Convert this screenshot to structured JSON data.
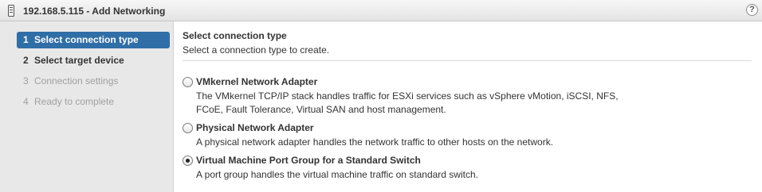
{
  "window": {
    "title": "192.168.5.115 - Add Networking",
    "host_icon": "host-server-icon",
    "help_icon": "help-icon",
    "help_glyph": "?"
  },
  "steps": [
    {
      "number": "1",
      "label": "Select connection type",
      "state": "active"
    },
    {
      "number": "2",
      "label": "Select target device",
      "state": "done"
    },
    {
      "number": "3",
      "label": "Connection settings",
      "state": "pending"
    },
    {
      "number": "4",
      "label": "Ready to complete",
      "state": "pending"
    }
  ],
  "main": {
    "heading": "Select connection type",
    "subheading": "Select a connection type to create.",
    "options": [
      {
        "title": "VMkernel Network Adapter",
        "description": "The VMkernel TCP/IP stack handles traffic for  ESXi services such as vSphere vMotion, iSCSI, NFS, FCoE, Fault Tolerance, Virtual SAN and host management.",
        "selected": false
      },
      {
        "title": "Physical Network Adapter",
        "description": "A physical network adapter handles the network traffic to other hosts on the network.",
        "selected": false
      },
      {
        "title": "Virtual Machine Port Group for a Standard Switch",
        "description": "A port group handles the virtual machine traffic on standard switch.",
        "selected": true
      }
    ]
  },
  "colors": {
    "active_step": "#2f6ea6",
    "sidebar_bg": "#e8e8e8",
    "pending_text": "#a0a0a0"
  }
}
